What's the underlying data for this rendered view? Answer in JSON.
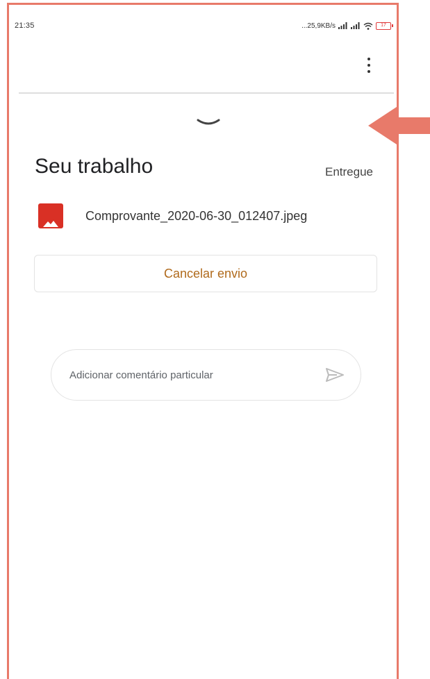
{
  "status_bar": {
    "time": "21:35",
    "network_speed": "...25,9KB/s",
    "battery_level": "17"
  },
  "app_bar": {
    "more_icon": "more-vert-icon"
  },
  "work": {
    "title": "Seu trabalho",
    "status": "Entregue",
    "attachment": {
      "file_name": "Comprovante_2020-06-30_012407.jpeg",
      "icon": "image-file-icon"
    },
    "cancel_label": "Cancelar envio"
  },
  "comment": {
    "placeholder": "Adicionar comentário particular",
    "value": ""
  },
  "colors": {
    "frame": "#e87a6a",
    "arrow": "#e87a6a",
    "image_icon": "#d93025",
    "cancel_text": "#b06a1c"
  }
}
